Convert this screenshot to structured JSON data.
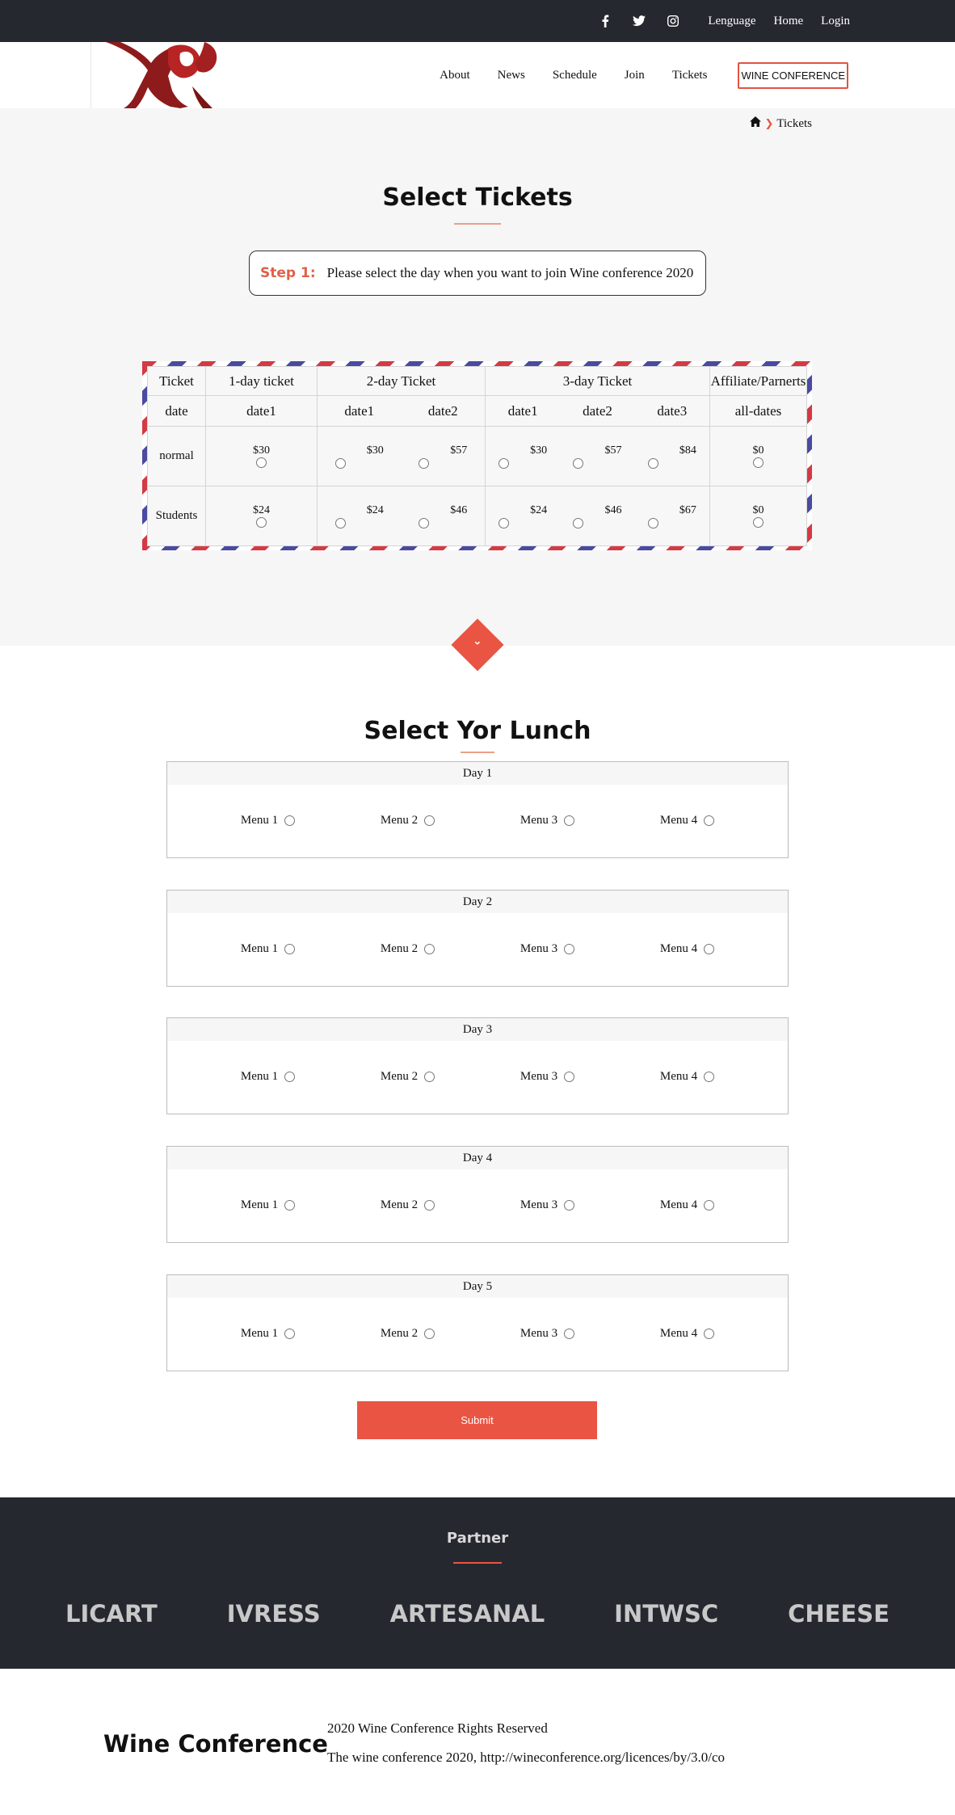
{
  "topbar": {
    "links": [
      "Lenguage",
      "Home",
      "Login"
    ],
    "social": [
      "facebook-icon",
      "twitter-icon",
      "instagram-icon"
    ]
  },
  "nav": {
    "items": [
      "About",
      "News",
      "Schedule",
      "Join",
      "Tickets"
    ],
    "highlight": "WINE CONFERENCE"
  },
  "breadcrumb": {
    "current": "Tickets"
  },
  "tickets": {
    "title": "Select Tickets",
    "step_label": "Step 1:",
    "step_text": "Please select the day when you want to join Wine conference 2020",
    "headers": [
      "Ticket",
      "1-day ticket",
      "2-day Ticket",
      "3-day Ticket",
      "Affiliate/Parnerts"
    ],
    "date_label": "date",
    "dates": {
      "one": [
        "date1"
      ],
      "two": [
        "date1",
        "date2"
      ],
      "three": [
        "date1",
        "date2",
        "date3"
      ],
      "aff": [
        "all-dates"
      ]
    },
    "rows": [
      {
        "label": "normal",
        "one": [
          "$30"
        ],
        "two": [
          "$30",
          "$57"
        ],
        "three": [
          "$30",
          "$57",
          "$84"
        ],
        "aff": [
          "$0"
        ]
      },
      {
        "label": "Students",
        "one": [
          "$24"
        ],
        "two": [
          "$24",
          "$46"
        ],
        "three": [
          "$24",
          "$46",
          "$67"
        ],
        "aff": [
          "$0"
        ]
      }
    ]
  },
  "lunch": {
    "title": "Select Yor Lunch",
    "days": [
      "Day 1",
      "Day 2",
      "Day 3",
      "Day 4",
      "Day 5"
    ],
    "menus": [
      "Menu 1",
      "Menu 2",
      "Menu 3",
      "Menu 4"
    ],
    "submit": "Submit"
  },
  "partner": {
    "title": "Partner",
    "brands": [
      "LICART",
      "IVRESS",
      "ARTESANAL",
      "INTWSC",
      "CHEESE"
    ]
  },
  "footer": {
    "name": "Wine Conference",
    "rights": "2020 Wine Conference Rights Reserved",
    "license": "The wine conference 2020, http://wineconference.org/licences/by/3.0/co"
  },
  "colors": {
    "accent": "#e95443",
    "dark": "#262830"
  }
}
